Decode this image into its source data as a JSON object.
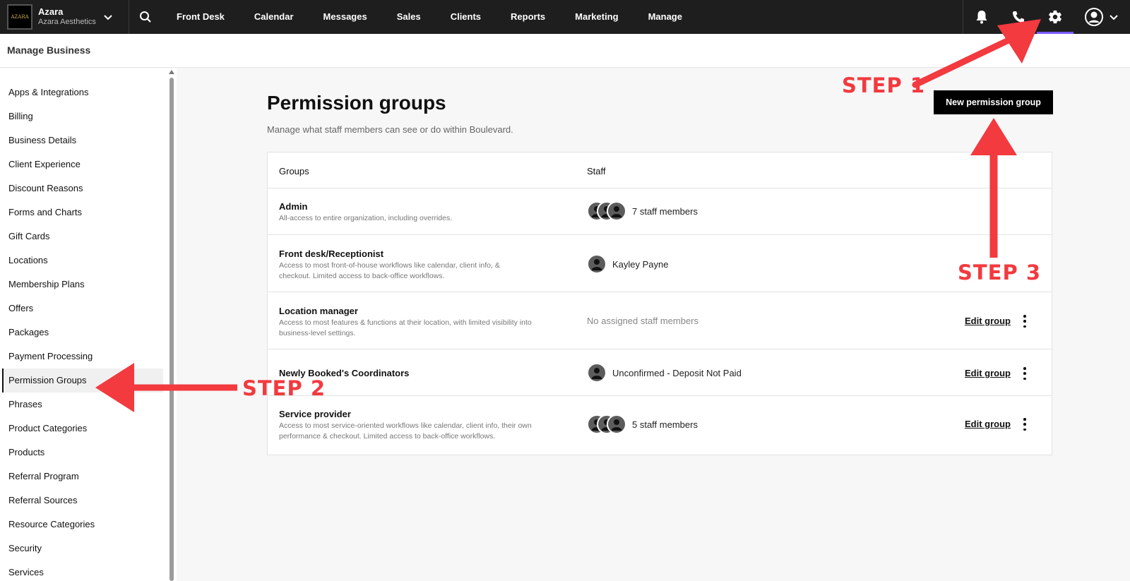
{
  "brand": {
    "name": "Azara",
    "subtitle": "Azara Aesthetics",
    "logo_text": "AZARA"
  },
  "nav": {
    "items": [
      "Front Desk",
      "Calendar",
      "Messages",
      "Sales",
      "Clients",
      "Reports",
      "Marketing",
      "Manage"
    ]
  },
  "subheader": {
    "title": "Manage Business"
  },
  "sidebar": {
    "items": [
      "Apps & Integrations",
      "Billing",
      "Business Details",
      "Client Experience",
      "Discount Reasons",
      "Forms and Charts",
      "Gift Cards",
      "Locations",
      "Membership Plans",
      "Offers",
      "Packages",
      "Payment Processing",
      "Permission Groups",
      "Phrases",
      "Product Categories",
      "Products",
      "Referral Program",
      "Referral Sources",
      "Resource Categories",
      "Security",
      "Services"
    ],
    "active": "Permission Groups"
  },
  "main": {
    "title": "Permission groups",
    "subtitle": "Manage what staff members can see or do within Boulevard.",
    "new_button": "New permission group",
    "headers": {
      "groups": "Groups",
      "staff": "Staff"
    },
    "edit_label": "Edit group",
    "rows": [
      {
        "name": "Admin",
        "desc": "All-access to entire organization, including overrides.",
        "staff": "7 staff members"
      },
      {
        "name": "Front desk/Receptionist",
        "desc": "Access to most front-of-house workflows like calendar, client info, & checkout. Limited access to back-office workflows.",
        "staff": "Kayley Payne"
      },
      {
        "name": "Location manager",
        "desc": "Access to most features & functions at their location, with limited visibility into business-level settings.",
        "staff": "No assigned staff members"
      },
      {
        "name": "Newly Booked's Coordinators",
        "desc": "",
        "staff": "Unconfirmed - Deposit Not Paid"
      },
      {
        "name": "Service provider",
        "desc": "Access to most service-oriented workflows like calendar, client info, their own performance & checkout. Limited access to back-office workflows.",
        "staff": "5 staff members"
      }
    ]
  },
  "annotations": {
    "step1": "STEP 1",
    "step2": "STEP 2",
    "step3": "STEP 3",
    "color": "#f23a3f"
  },
  "colors": {
    "topbar": "#1e1e1e",
    "accent": "#7a5cff"
  }
}
